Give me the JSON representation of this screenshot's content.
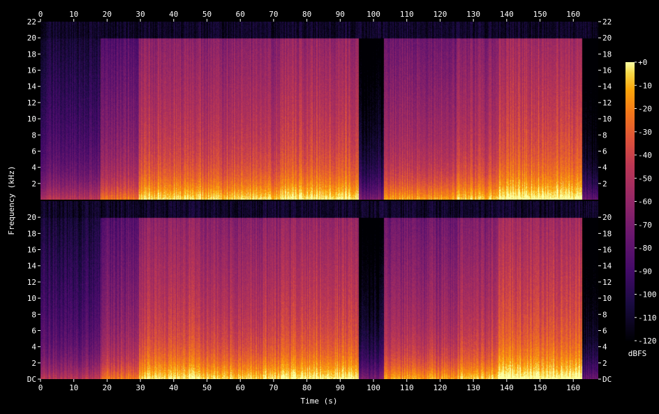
{
  "chart_data": {
    "type": "heatmap",
    "title": "",
    "xlabel": "Time (s)",
    "ylabel": "Frequency (kHz)",
    "colorbar_label": "dBFS",
    "xlim": [
      0,
      167.5
    ],
    "ylim": [
      0,
      22
    ],
    "x_ticks": [
      0,
      10,
      20,
      30,
      40,
      50,
      60,
      70,
      80,
      90,
      100,
      110,
      120,
      130,
      140,
      150,
      160
    ],
    "x_tick_labels": [
      "0",
      "10",
      "20",
      "30",
      "40",
      "50",
      "60",
      "70",
      "80",
      "90",
      "100",
      "110",
      "120",
      "130",
      "140",
      "150",
      "160"
    ],
    "y_ticks_top": [
      2,
      4,
      6,
      8,
      10,
      12,
      14,
      16,
      18,
      20,
      22
    ],
    "y_tick_labels_top": [
      "2",
      "4",
      "6",
      "8",
      "10",
      "12",
      "14",
      "16",
      "18",
      "20",
      "22"
    ],
    "y_ticks_bottom": [
      0,
      2,
      4,
      6,
      8,
      10,
      12,
      14,
      16,
      18,
      20
    ],
    "y_tick_labels_bottom": [
      "DC",
      "2",
      "4",
      "6",
      "8",
      "10",
      "12",
      "14",
      "16",
      "18",
      "20"
    ],
    "colorbar_range": [
      -120,
      0
    ],
    "colorbar_ticks": [
      0,
      -10,
      -20,
      -30,
      -40,
      -50,
      -60,
      -70,
      -80,
      -90,
      -100,
      -110,
      -120
    ],
    "colorbar_tick_labels": [
      "+0",
      "-10",
      "-20",
      "-30",
      "-40",
      "-50",
      "-60",
      "-70",
      "-80",
      "-90",
      "-100",
      "-110",
      "-120"
    ],
    "channels": [
      "top",
      "bottom"
    ],
    "segments": [
      {
        "t0": 0,
        "t1": 18,
        "level": 0.35
      },
      {
        "t0": 18,
        "t1": 29.5,
        "level": 0.55
      },
      {
        "t0": 29.5,
        "t1": 47,
        "level": 0.72
      },
      {
        "t0": 47,
        "t1": 72,
        "level": 0.7
      },
      {
        "t0": 72,
        "t1": 95.5,
        "level": 0.74
      },
      {
        "t0": 95.5,
        "t1": 103,
        "level": 0.15
      },
      {
        "t0": 103,
        "t1": 125,
        "level": 0.62
      },
      {
        "t0": 125,
        "t1": 137.5,
        "level": 0.68
      },
      {
        "t0": 137.5,
        "t1": 162.5,
        "level": 0.78
      },
      {
        "t0": 162.5,
        "t1": 167.5,
        "level": 0.1
      }
    ],
    "grid": false,
    "legend": "colorbar-right"
  }
}
